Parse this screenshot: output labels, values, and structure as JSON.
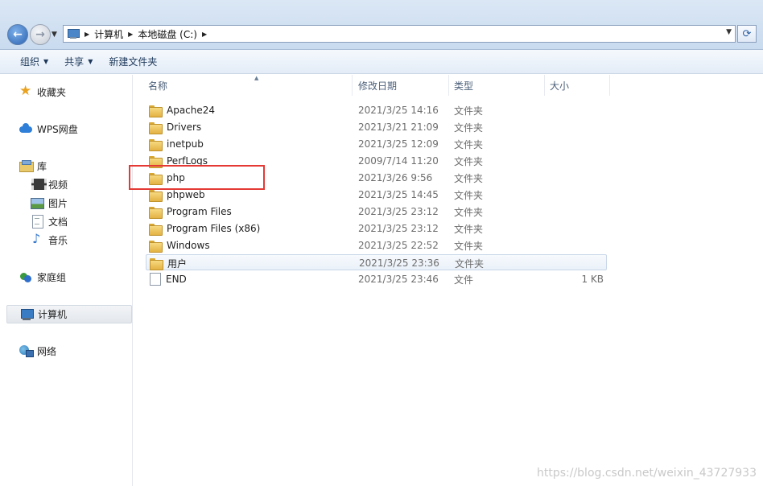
{
  "address_bar": {
    "breadcrumbs": [
      "计算机",
      "本地磁盘 (C:)"
    ]
  },
  "toolbar": {
    "organize": "组织",
    "share": "共享",
    "new_folder": "新建文件夹"
  },
  "sidebar": {
    "favorites": "收藏夹",
    "wps": "WPS网盘",
    "library": "库",
    "video": "视频",
    "pictures": "图片",
    "documents": "文档",
    "music": "音乐",
    "homegroup": "家庭组",
    "computer": "计算机",
    "network": "网络"
  },
  "columns": {
    "name": "名称",
    "date": "修改日期",
    "type": "类型",
    "size": "大小"
  },
  "files": [
    {
      "name": "Apache24",
      "date": "2021/3/25 14:16",
      "type": "文件夹",
      "size": ""
    },
    {
      "name": "Drivers",
      "date": "2021/3/21 21:09",
      "type": "文件夹",
      "size": ""
    },
    {
      "name": "inetpub",
      "date": "2021/3/25 12:09",
      "type": "文件夹",
      "size": ""
    },
    {
      "name": "PerfLogs",
      "date": "2009/7/14 11:20",
      "type": "文件夹",
      "size": ""
    },
    {
      "name": "php",
      "date": "2021/3/26 9:56",
      "type": "文件夹",
      "size": ""
    },
    {
      "name": "phpweb",
      "date": "2021/3/25 14:45",
      "type": "文件夹",
      "size": ""
    },
    {
      "name": "Program Files",
      "date": "2021/3/25 23:12",
      "type": "文件夹",
      "size": ""
    },
    {
      "name": "Program Files (x86)",
      "date": "2021/3/25 23:12",
      "type": "文件夹",
      "size": ""
    },
    {
      "name": "Windows",
      "date": "2021/3/25 22:52",
      "type": "文件夹",
      "size": ""
    },
    {
      "name": "用户",
      "date": "2021/3/25 23:36",
      "type": "文件夹",
      "size": ""
    },
    {
      "name": "END",
      "date": "2021/3/25 23:46",
      "type": "文件",
      "size": "1 KB"
    }
  ],
  "watermark": "https://blog.csdn.net/weixin_43727933"
}
